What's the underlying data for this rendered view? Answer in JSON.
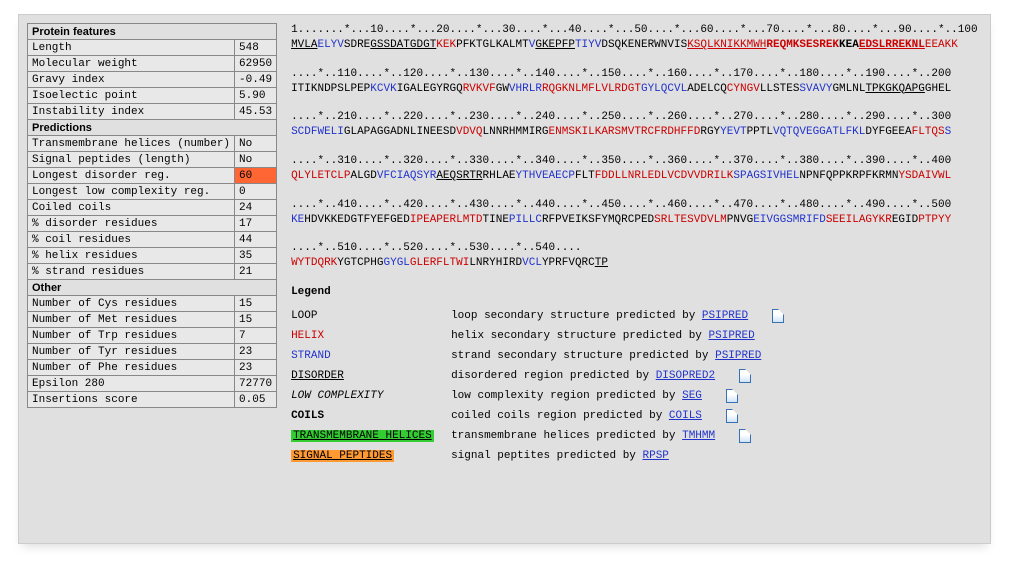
{
  "features": {
    "headers": {
      "protein": "Protein features",
      "predictions": "Predictions",
      "other": "Other"
    },
    "protein": [
      {
        "label": "Length",
        "value": "548"
      },
      {
        "label": "Molecular weight",
        "value": "62950"
      },
      {
        "label": "Gravy index",
        "value": "-0.49"
      },
      {
        "label": "Isoelectic point",
        "value": "5.90"
      },
      {
        "label": "Instability index",
        "value": "45.53"
      }
    ],
    "predictions": [
      {
        "label": "Transmembrane helices (number)",
        "value": "No"
      },
      {
        "label": "Signal peptides (length)",
        "value": "No"
      },
      {
        "label": "Longest disorder reg.",
        "value": "60",
        "hl": true
      },
      {
        "label": "Longest low complexity reg.",
        "value": "0"
      },
      {
        "label": "Coiled coils",
        "value": "24"
      },
      {
        "label": "% disorder residues",
        "value": "17"
      },
      {
        "label": "% coil residues",
        "value": "44"
      },
      {
        "label": "% helix residues",
        "value": "35"
      },
      {
        "label": "% strand residues",
        "value": "21"
      }
    ],
    "other": [
      {
        "label": "Number of Cys residues",
        "value": "15"
      },
      {
        "label": "Number of Met residues",
        "value": "15"
      },
      {
        "label": "Number of Trp residues",
        "value": "7"
      },
      {
        "label": "Number of Tyr residues",
        "value": "23"
      },
      {
        "label": "Number of Phe residues",
        "value": "23"
      },
      {
        "label": "Epsilon 280",
        "value": "72770"
      },
      {
        "label": "Insertions score",
        "value": "0.05"
      }
    ]
  },
  "rulers": {
    "r1": "1.......*...10....*...20....*...30....*...40....*...50....*...60....*...70....*...80....*...90....*..100",
    "r2": "....*..110....*..120....*..130....*..140....*..150....*..160....*..170....*..180....*..190....*..200",
    "r3": "....*..210....*..220....*..230....*..240....*..250....*..260....*..270....*..280....*..290....*..300",
    "r4": "....*..310....*..320....*..330....*..340....*..350....*..360....*..370....*..380....*..390....*..400",
    "r5": "....*..410....*..420....*..430....*..440....*..450....*..460....*..470....*..480....*..490....*..500",
    "r6": "....*..510....*..520....*..530....*..540...."
  },
  "seq": {
    "l1": {
      "a": "MVLA",
      "b": "ELYV",
      "c": "SDRE",
      "d": "GSSDATGDGT",
      "e": "KEK",
      "f": "PFKTGLKALMT",
      "g": "V",
      "h": "GKEPFP",
      "i": "TIYV",
      "j": "DSQKENERWNVIS",
      "k": "KSQLKNIKKMWH",
      "l": "REQMKSESREK",
      "m": "KEA",
      "n": "EDSLRREKNL",
      "o": "EEAKK"
    },
    "l2": {
      "a": "ITIKNDPSLPEP",
      "b": "KCVK",
      "c": "IGALEGYRGQ",
      "d": "RVKVF",
      "e": "GW",
      "f": "VHRLR",
      "g": "RQGKNLMFLVLRDGT",
      "h": "GYLQCVL",
      "i": "ADELCQ",
      "j": "CYNGV",
      "k": "LLSTES",
      "l": "SVAVY",
      "m": "GMLNL",
      "n": "TPKGKQAPG",
      "o": "GHEL"
    },
    "l3": {
      "a": "SCDFWELI",
      "b": "GLAPAGGADNLINEESD",
      "c": "VDVQ",
      "d": "LNNRHMMIRG",
      "e": "ENMSKILKARSMVTRCFRDHFFD",
      "f": "RGY",
      "g": "YEVT",
      "h": "PPTL",
      "i": "VQTQVEGGATLFKL",
      "j": "DYFGEEA",
      "k": "FLTQS",
      "l": "S"
    },
    "l4": {
      "a": "QLYLETCLP",
      "b": "ALGD",
      "c": "VFCIAQSYR",
      "d": "AEQSRTR",
      "e": "RHLAE",
      "f": "YTHVEAECP",
      "g": "FLT",
      "h": "FDDLLNRLEDLVCDVVDRILK",
      "i": "SPAGSIVHEL",
      "j": "NPNFQPPKRPFKRMN",
      "k": "YSDAIVWL"
    },
    "l5": {
      "a": "KE",
      "b": "HDVKKEDGTFYEFGED",
      "c": "IPEAPERLMTD",
      "d": "TINE",
      "e": "PILLC",
      "f": "RFPVEIKSFYMQRCPED",
      "g": "SRLTESVDVLM",
      "h": "PNVG",
      "i": "EIVGGSMRIFD",
      "j": "SEEILAGYKR",
      "k": "EGID",
      "l": "PTPYY"
    },
    "l6": {
      "a": "WYTDQRK",
      "b": "YGTCPHG",
      "c": "GYGL",
      "d": "GLERFLTWI",
      "e": "LNRYHIRD",
      "f": "VCL",
      "g": "YPRFVQRC",
      "h": "TP"
    }
  },
  "legend": {
    "title": "Legend",
    "rows": [
      {
        "key": "LOOP",
        "cls": "blk",
        "desc": "loop secondary structure predicted by ",
        "link": "PSIPRED",
        "icon": true
      },
      {
        "key": "HELIX",
        "cls": "red",
        "desc": "helix secondary structure predicted by ",
        "link": "PSIPRED",
        "icon": false
      },
      {
        "key": "STRAND",
        "cls": "blue",
        "desc": "strand secondary structure predicted by ",
        "link": "PSIPRED",
        "icon": false
      },
      {
        "key": "DISORDER",
        "cls": "und",
        "desc": "disordered region predicted by ",
        "link": "DISOPRED2",
        "icon": true
      },
      {
        "key": "LOW COMPLEXITY",
        "cls": "italic",
        "desc": "low complexity region predicted by ",
        "link": "SEG",
        "icon": true
      },
      {
        "key": "COILS",
        "cls": "bold",
        "desc": "coiled coils region predicted by ",
        "link": "COILS",
        "icon": true
      },
      {
        "key": "TRANSMEMBRANE HELICES",
        "cls": "green-bg",
        "desc": "transmembrane helices predicted by ",
        "link": "TMHMM",
        "icon": true
      },
      {
        "key": "SIGNAL PEPTIDES",
        "cls": "orange-bg",
        "desc": "signal peptites predicted by ",
        "link": "RPSP",
        "icon": false
      }
    ]
  }
}
